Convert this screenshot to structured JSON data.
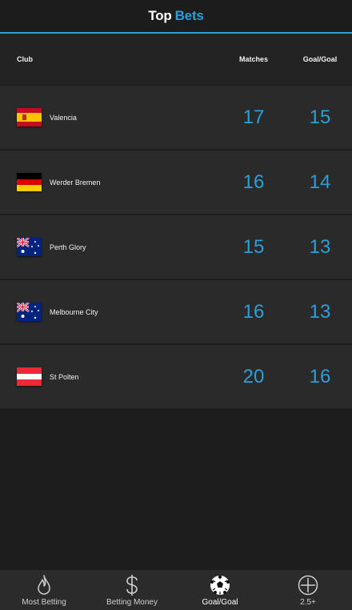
{
  "header": {
    "title_part1": "Top",
    "title_part2": "Bets",
    "accent_color": "#2b9fd8"
  },
  "columns": {
    "club": "Club",
    "matches": "Matches",
    "goal": "Goal/Goal"
  },
  "rows": [
    {
      "club": "Valencia",
      "flag": "spain-flag-icon",
      "matches": "17",
      "goals": "15"
    },
    {
      "club": "Werder Bremen",
      "flag": "germany-flag-icon",
      "matches": "16",
      "goals": "14"
    },
    {
      "club": "Perth Glory",
      "flag": "australia-flag-icon",
      "matches": "15",
      "goals": "13"
    },
    {
      "club": "Melbourne City",
      "flag": "australia-flag-icon",
      "matches": "16",
      "goals": "13"
    },
    {
      "club": "St Polten",
      "flag": "austria-flag-icon",
      "matches": "20",
      "goals": "16"
    }
  ],
  "tabs": [
    {
      "label": "Most Betting",
      "icon": "flame-icon",
      "active": false
    },
    {
      "label": "Betting Money",
      "icon": "dollar-icon",
      "active": false
    },
    {
      "label": "Goal/Goal",
      "icon": "soccer-ball-icon",
      "active": true
    },
    {
      "label": "2.5+",
      "icon": "plus-circle-icon",
      "active": false
    }
  ]
}
